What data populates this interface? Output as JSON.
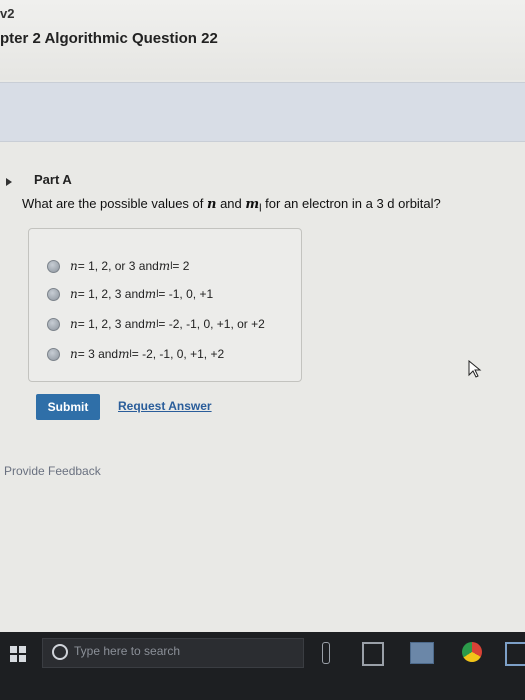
{
  "header": {
    "crumb": "v2",
    "title": "pter 2 Algorithmic Question 22"
  },
  "part": {
    "label": "Part A"
  },
  "question": {
    "prefix": "What are the possible values of ",
    "var_n": "n",
    "mid": " and ",
    "var_ml": "m",
    "var_ml_sub": "l",
    "suffix": " for an electron in a 3 d orbital?"
  },
  "options": [
    {
      "n_text": "n",
      "a": " = 1, 2, or 3 and ",
      "m": "m",
      "sub": "l",
      "b": " = 2"
    },
    {
      "n_text": "n",
      "a": " = 1, 2, 3 and ",
      "m": "m",
      "sub": "l",
      "b": " = -1, 0, +1"
    },
    {
      "n_text": "n",
      "a": " = 1, 2, 3 and ",
      "m": "m",
      "sub": "l",
      "b": " = -2, -1, 0, +1, or +2"
    },
    {
      "n_text": "n",
      "a": " = 3 and ",
      "m": "m",
      "sub": "l",
      "b": " = -2, -1, 0, +1, +2"
    }
  ],
  "actions": {
    "submit": "Submit",
    "request": "Request Answer",
    "feedback": "Provide Feedback"
  },
  "taskbar": {
    "search_placeholder": "Type here to search"
  }
}
